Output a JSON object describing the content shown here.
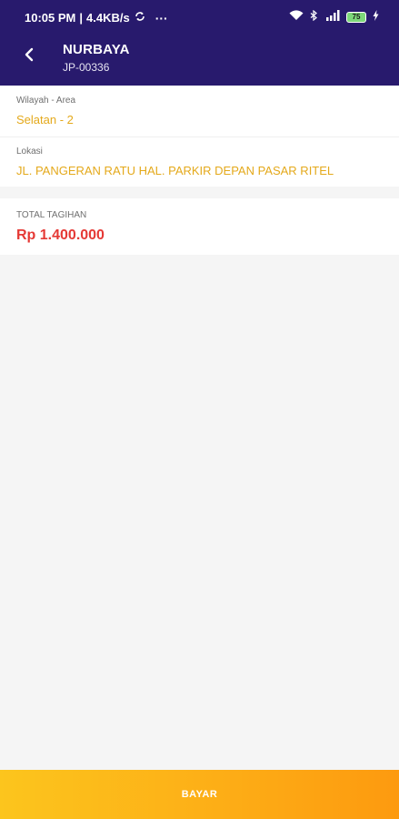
{
  "status_bar": {
    "time": "10:05 PM",
    "speed": "4.4KB/s",
    "more": "···",
    "battery_level": "75"
  },
  "header": {
    "title": "NURBAYA",
    "subtitle": "JP-00336",
    "background_color": "#281a6d"
  },
  "details": {
    "wilayah_label": "Wilayah - Area",
    "wilayah_value": "Selatan - 2",
    "lokasi_label": "Lokasi",
    "lokasi_value": "JL. PANGERAN RATU HAL. PARKIR DEPAN PASAR RITEL",
    "value_color": "#e4a91b"
  },
  "billing": {
    "total_label": "TOTAL TAGIHAN",
    "total_value": "Rp 1.400.000",
    "total_color": "#e53935"
  },
  "footer": {
    "pay_label": "BAYAR"
  },
  "icons": {
    "back": "chevron-left-icon",
    "sync": "sync-icon",
    "wifi": "wifi-icon",
    "bluetooth": "bluetooth-icon",
    "signal": "signal-icon",
    "battery": "battery-icon",
    "charging": "charging-icon"
  }
}
